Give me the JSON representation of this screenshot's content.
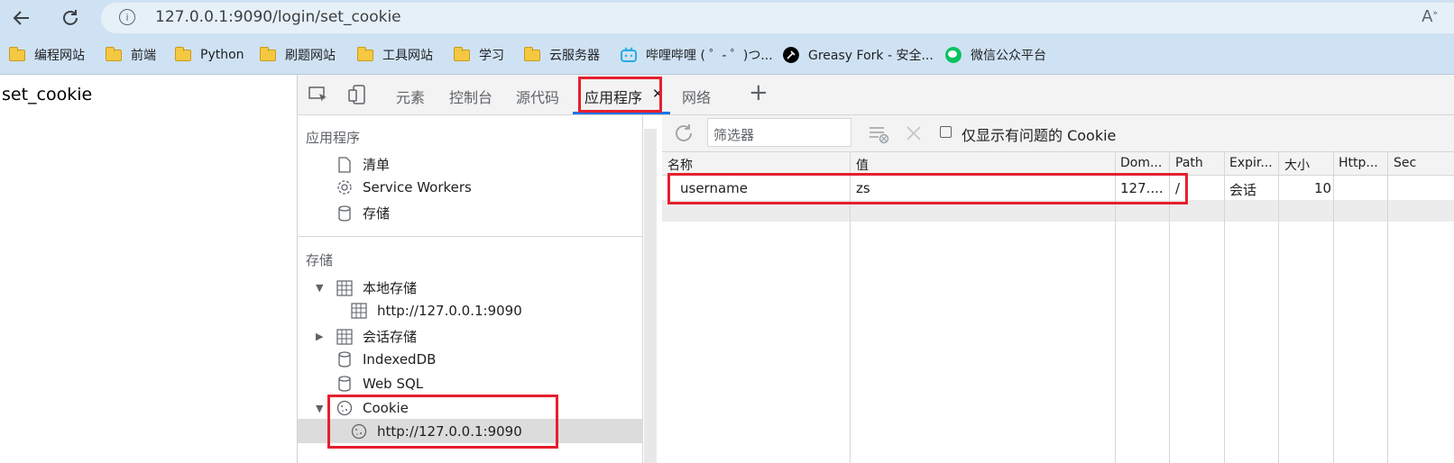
{
  "browser": {
    "url": "127.0.0.1:9090/login/set_cookie",
    "bookmarks": [
      {
        "label": "编程网站",
        "icon": "folder-icon"
      },
      {
        "label": "前端",
        "icon": "folder-icon"
      },
      {
        "label": "Python",
        "icon": "folder-icon"
      },
      {
        "label": "刷题网站",
        "icon": "folder-icon"
      },
      {
        "label": "工具网站",
        "icon": "folder-icon"
      },
      {
        "label": "学习",
        "icon": "folder-icon"
      },
      {
        "label": "云服务器",
        "icon": "folder-icon"
      },
      {
        "label": "哔哩哔哩 ( ゜- ゜)つ...",
        "icon": "bilibili-icon"
      },
      {
        "label": "Greasy Fork - 安全...",
        "icon": "greasyfork-icon"
      },
      {
        "label": "微信公众平台",
        "icon": "wechat-icon"
      }
    ]
  },
  "page": {
    "text": "set_cookie"
  },
  "devtools": {
    "tabs": [
      "元素",
      "控制台",
      "源代码",
      "应用程序",
      "网络"
    ],
    "active_tab": "应用程序",
    "sidebar": {
      "app_section": "应用程序",
      "app_items": [
        "清单",
        "Service Workers",
        "存储"
      ],
      "storage_section": "存储",
      "local_storage": "本地存储",
      "local_storage_origin": "http://127.0.0.1:9090",
      "session_storage": "会话存储",
      "indexeddb": "IndexedDB",
      "websql": "Web SQL",
      "cookie": "Cookie",
      "cookie_origin": "http://127.0.0.1:9090"
    },
    "filter_placeholder": "筛选器",
    "only_issues_label": "仅显示有问题的 Cookie",
    "table": {
      "headers": [
        "名称",
        "值",
        "Dom...",
        "Path",
        "Expir...",
        "大小",
        "Http...",
        "Sec"
      ],
      "rows": [
        [
          "username",
          "zs",
          "127....",
          "/",
          "会话",
          "10",
          "",
          ""
        ]
      ]
    }
  },
  "colors": {
    "highlight": "#e5202e",
    "accent": "#1a73e8",
    "toolbar_bg": "#cfe2f3"
  }
}
